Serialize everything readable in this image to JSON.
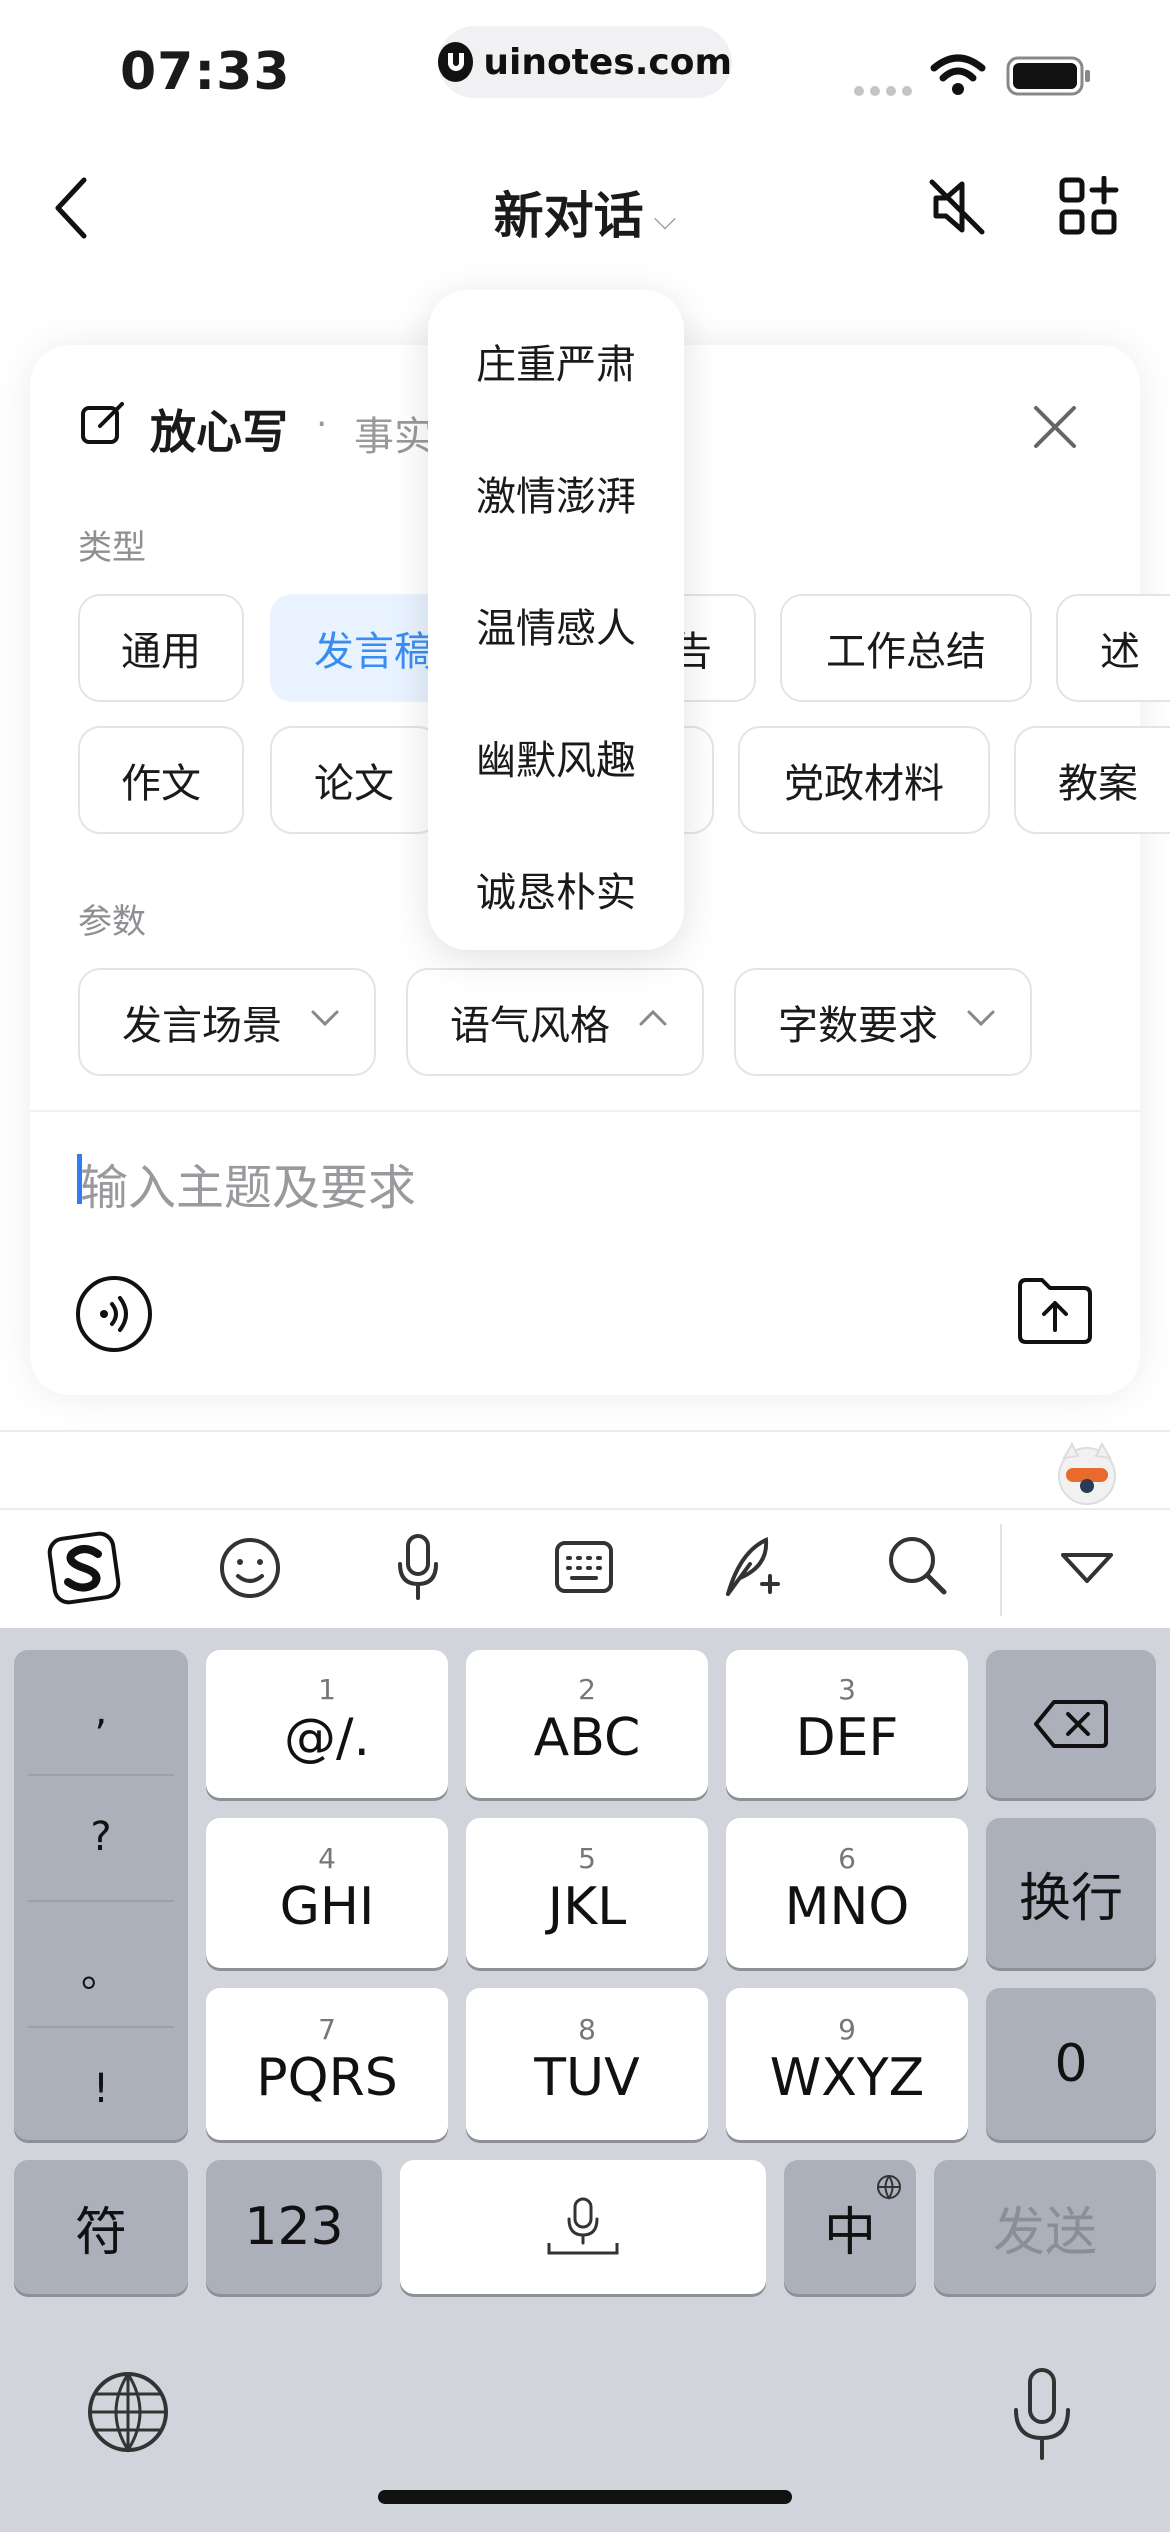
{
  "status_bar": {
    "time": "07:33",
    "url": "uinotes.com"
  },
  "nav": {
    "title": "新对话",
    "title_chevron": "⌵"
  },
  "card": {
    "title": "放心写",
    "separator": "·",
    "subtitle": "事实",
    "type_label": "类型",
    "types_row1": [
      "通用",
      "发言稿",
      "告",
      "工作总结",
      "述"
    ],
    "types_row2": [
      "作文",
      "论文",
      "",
      "党政材料",
      "教案"
    ],
    "param_label": "参数",
    "params": [
      "发言场景",
      "语气风格",
      "字数要求"
    ],
    "input_placeholder": "输入主题及要求"
  },
  "dropdown": {
    "options": [
      "庄重严肃",
      "激情澎湃",
      "温情感人",
      "幽默风趣",
      "诚恳朴实"
    ]
  },
  "keyboard": {
    "punctuation": [
      ",",
      "?",
      "。",
      "!"
    ],
    "keys": [
      {
        "num": "1",
        "label": "@/."
      },
      {
        "num": "2",
        "label": "ABC"
      },
      {
        "num": "3",
        "label": "DEF"
      },
      {
        "num": "4",
        "label": "GHI"
      },
      {
        "num": "5",
        "label": "JKL"
      },
      {
        "num": "6",
        "label": "MNO"
      },
      {
        "num": "7",
        "label": "PQRS"
      },
      {
        "num": "8",
        "label": "TUV"
      },
      {
        "num": "9",
        "label": "WXYZ"
      }
    ],
    "newline": "换行",
    "zero": "0",
    "symbols": "符",
    "numbers": "123",
    "lang": "中",
    "send": "发送"
  },
  "colors": {
    "accent": "#3a8df0",
    "keyboard_bg": "#d1d4da",
    "dark_key": "#abb0ba"
  }
}
